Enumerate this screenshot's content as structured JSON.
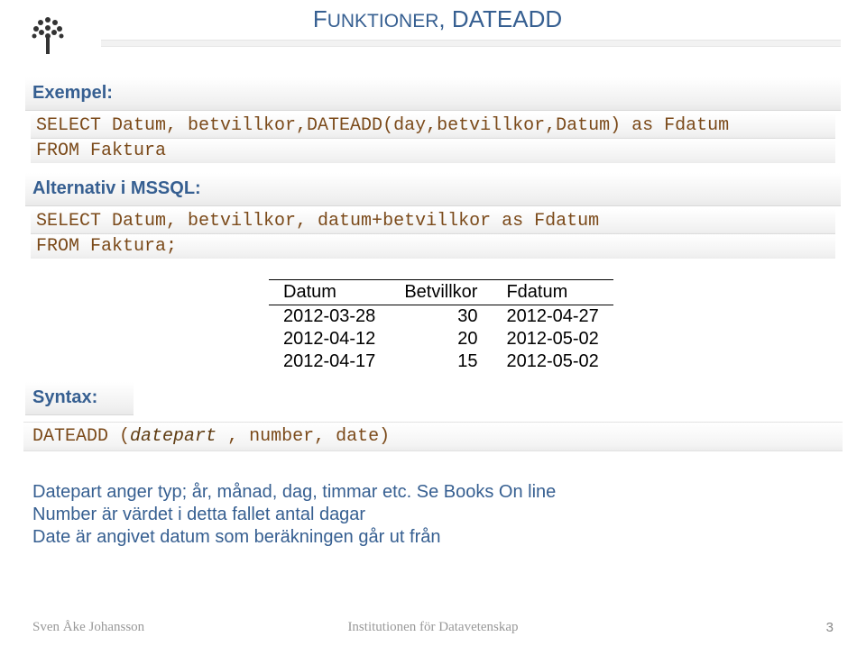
{
  "header": {
    "title_part1": "F",
    "title_word1_rest": "UNKTIONER",
    "title_sep": ", ",
    "title_word2": "DATEADD"
  },
  "example": {
    "label": "Exempel:",
    "code_lines": [
      "SELECT Datum, betvillkor,DATEADD(day,betvillkor,Datum) as Fdatum",
      "FROM Faktura"
    ]
  },
  "alt": {
    "label": "Alternativ i MSSQL:",
    "code_lines": [
      "SELECT Datum, betvillkor, datum+betvillkor as Fdatum",
      "FROM Faktura;"
    ]
  },
  "table": {
    "headers": [
      "Datum",
      "Betvillkor",
      "Fdatum"
    ],
    "rows": [
      [
        "2012-03-28",
        "30",
        "2012-04-27"
      ],
      [
        "2012-04-12",
        "20",
        "2012-05-02"
      ],
      [
        "2012-04-17",
        "15",
        "2012-05-02"
      ]
    ]
  },
  "syntax": {
    "label": "Syntax:",
    "func": "DATEADD (",
    "arg": "datepart ",
    "rest": ", number, date)"
  },
  "desc": {
    "l1_a": "Datepart anger typ;  år, månad, dag, timmar etc. ",
    "l1_b": "Se Books On line",
    "l2": "Number är värdet i detta fallet antal dagar",
    "l3": "Date är angivet datum som beräkningen går ut från"
  },
  "footer": {
    "author": "Sven Åke Johansson",
    "center": "Institutionen för Datavetenskap",
    "page": "3"
  }
}
